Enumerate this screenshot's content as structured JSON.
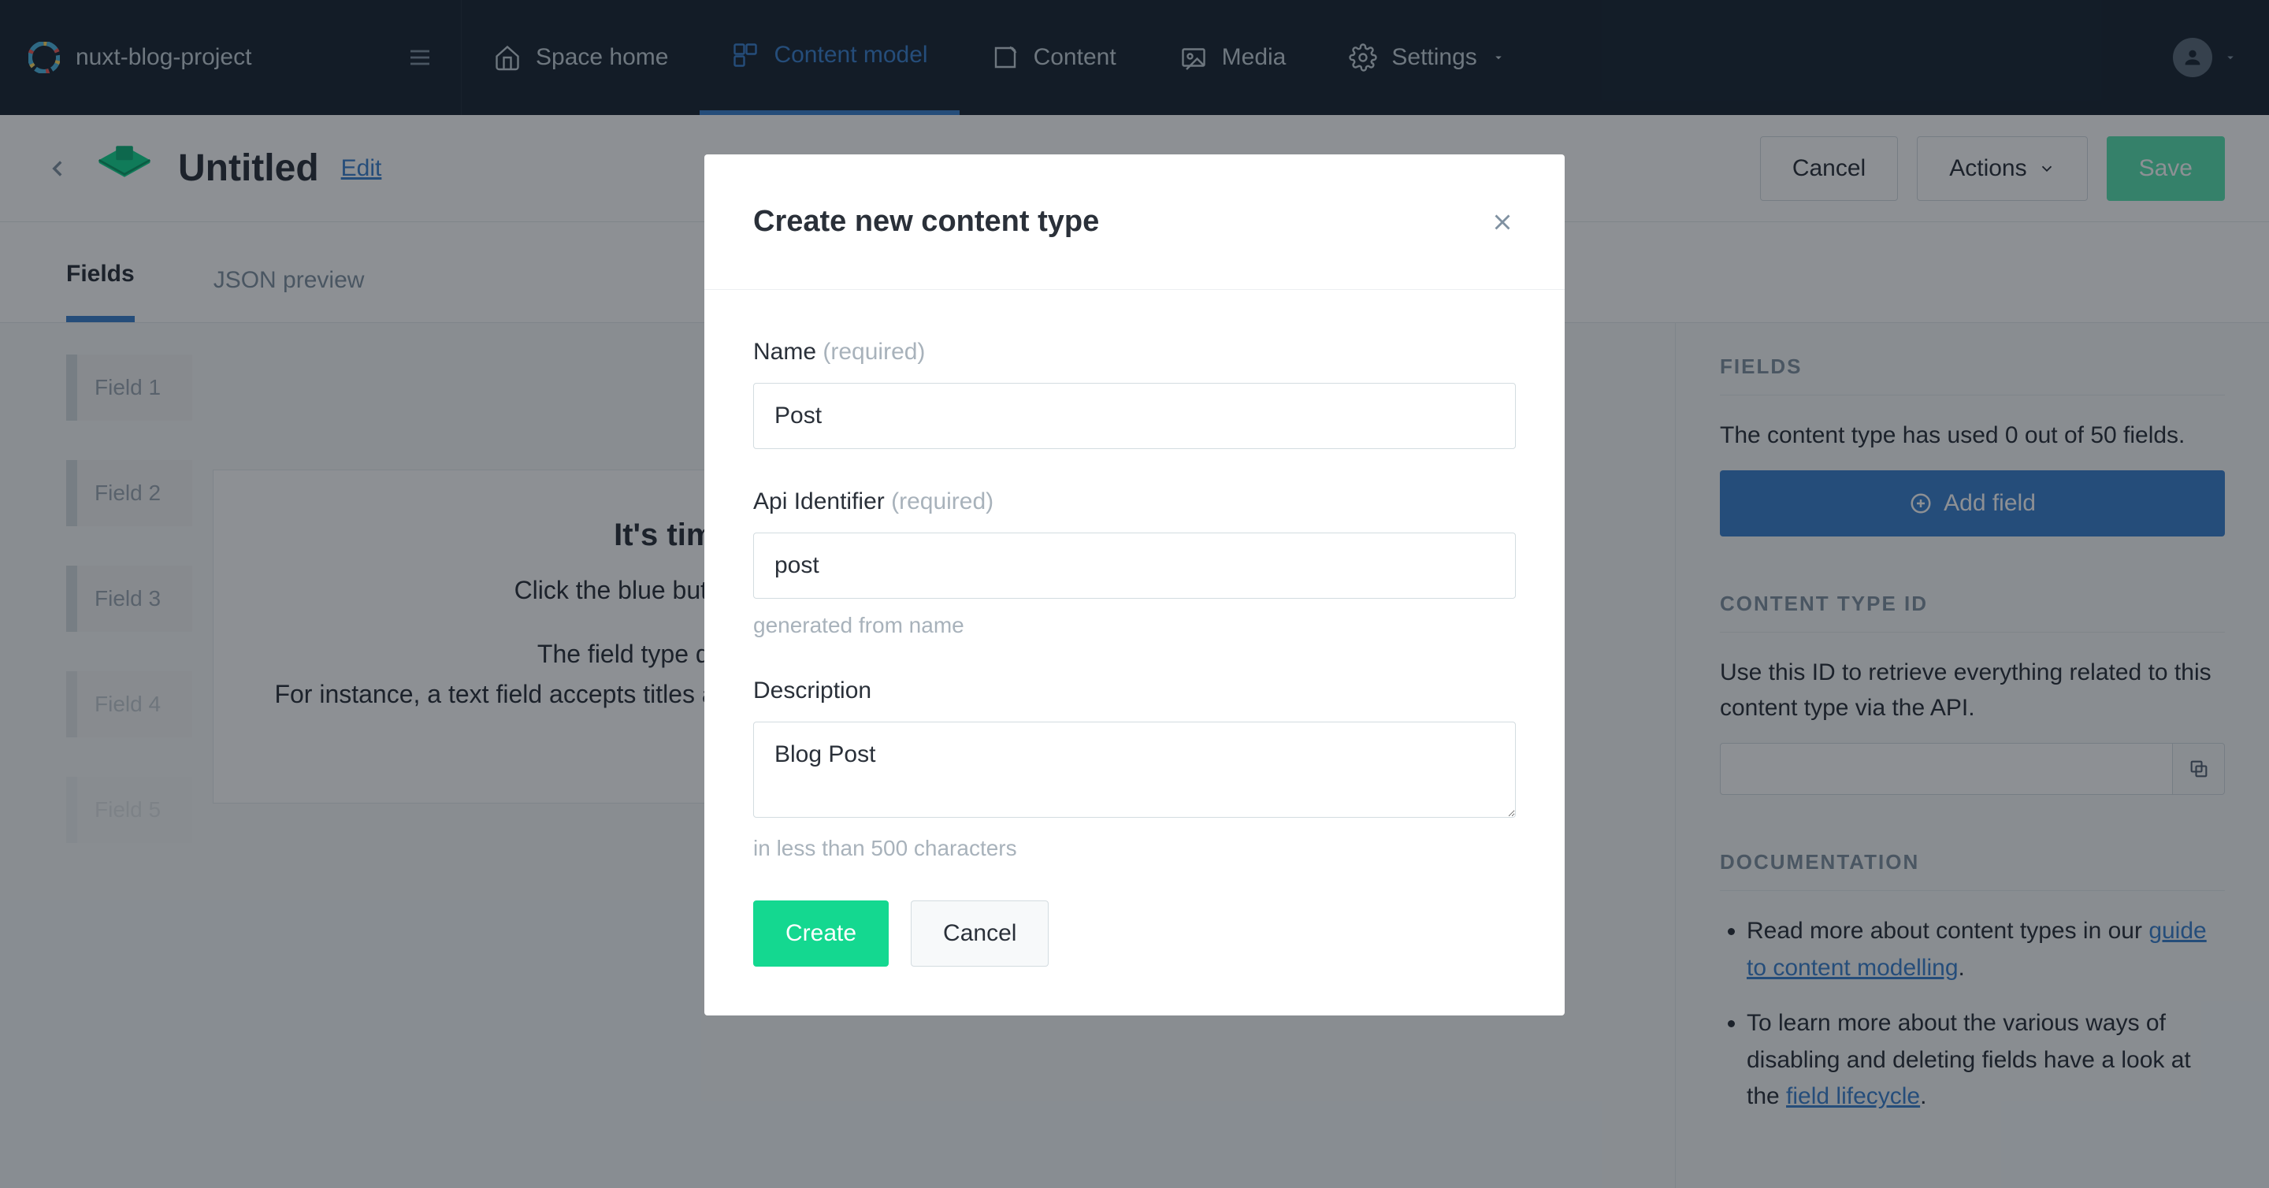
{
  "brand": {
    "project": "nuxt-blog-project"
  },
  "nav": {
    "space_home": "Space home",
    "content_model": "Content model",
    "content": "Content",
    "media": "Media",
    "settings": "Settings"
  },
  "subheader": {
    "title": "Untitled",
    "edit": "Edit",
    "cancel": "Cancel",
    "actions": "Actions",
    "save": "Save"
  },
  "tabs": {
    "fields": "Fields",
    "json": "JSON preview"
  },
  "skeleton": {
    "f1": "Field 1",
    "f2": "Field 2",
    "f3": "Field 3",
    "f4": "Field 4",
    "f5": "Field 5"
  },
  "onboard": {
    "title": "It's time to add some fields",
    "l1": "Click the blue button on the right to add your first field.",
    "l2": "The field type defines what content can be stored.",
    "l3": "For instance, a text field accepts titles and descriptions, whereas a media field is used for images and videos."
  },
  "sidebar": {
    "fields_h": "FIELDS",
    "fields_text": "The content type has used 0 out of 50 fields.",
    "add_field": "Add field",
    "ctid_h": "CONTENT TYPE ID",
    "ctid_text": "Use this ID to retrieve everything related to this content type via the API.",
    "ctid_value": "",
    "doc_h": "DOCUMENTATION",
    "doc1_pre": "Read more about content types in our ",
    "doc1_link": "guide to content modelling",
    "doc2_pre": "To learn more about the various ways of disabling and deleting fields have a look at the ",
    "doc2_link": "field lifecycle"
  },
  "modal": {
    "title": "Create new content type",
    "name_label": "Name",
    "required": "(required)",
    "name_value": "Post",
    "api_label": "Api Identifier",
    "api_value": "post",
    "api_hint": "generated from name",
    "desc_label": "Description",
    "desc_value": "Blog Post",
    "desc_hint": "in less than 500 characters",
    "create": "Create",
    "cancel": "Cancel"
  }
}
